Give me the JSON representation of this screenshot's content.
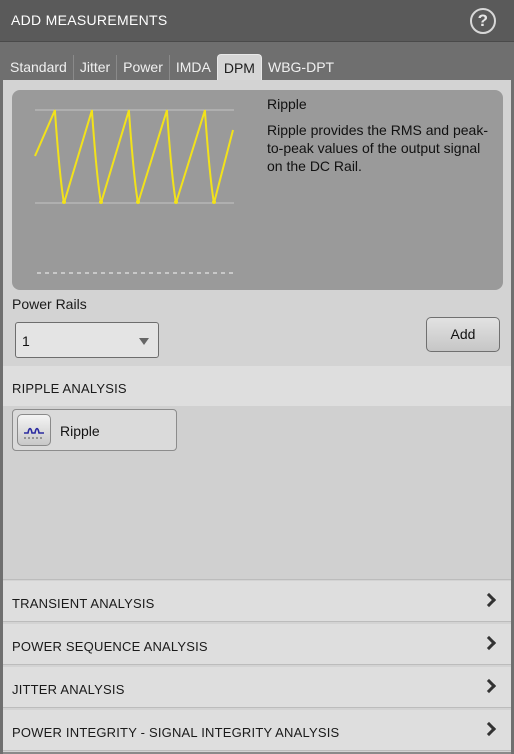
{
  "window": {
    "title": "ADD MEASUREMENTS",
    "help_icon": "help-circle-icon"
  },
  "tabs": [
    {
      "label": "Standard"
    },
    {
      "label": "Jitter"
    },
    {
      "label": "Power"
    },
    {
      "label": "IMDA"
    },
    {
      "label": "DPM",
      "active": true
    },
    {
      "label": "WBG-DPT"
    }
  ],
  "preview": {
    "title": "Ripple",
    "description": "Ripple provides the RMS and peak-to-peak values of the output signal on the DC Rail.",
    "waveform_color": "#f2e21a"
  },
  "power_rails": {
    "label": "Power Rails",
    "value": "1"
  },
  "add_button": {
    "label": "Add"
  },
  "sections": {
    "ripple": {
      "label": "RIPPLE ANALYSIS",
      "items": [
        {
          "label": "Ripple",
          "icon": "ripple-waveform-icon"
        }
      ]
    },
    "transient": {
      "label": "TRANSIENT ANALYSIS"
    },
    "power_sequence": {
      "label": "POWER SEQUENCE ANALYSIS"
    },
    "jitter": {
      "label": "JITTER ANALYSIS"
    },
    "pi_si": {
      "label": "POWER INTEGRITY - SIGNAL INTEGRITY ANALYSIS"
    }
  },
  "colors": {
    "background": "#6f6f6f",
    "panel": "#d3d3d3",
    "accent_waveform": "#f2e21a"
  }
}
